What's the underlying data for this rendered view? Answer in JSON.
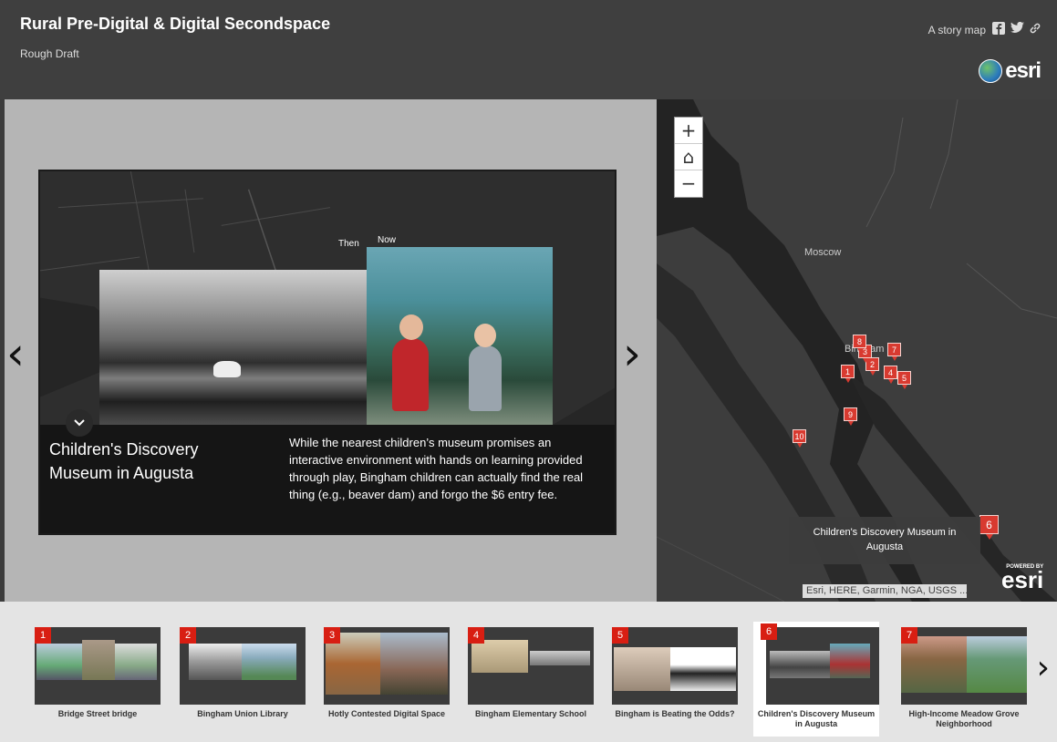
{
  "header": {
    "title": "Rural Pre-Digital & Digital Secondspace",
    "subtitle": "Rough Draft",
    "story_link": "A story map",
    "share_icons": [
      "facebook-icon",
      "twitter-icon",
      "link-icon"
    ],
    "logo_text": "esri"
  },
  "slide": {
    "then_label": "Then",
    "now_label": "Now",
    "title": "Children's Discovery Museum in Augusta",
    "description": "While the nearest children’s museum promises an interactive environment with hands on learning provided through play, Bingham children can actually find the real thing (e.g., beaver dam) and forgo the $6 entry fee.",
    "prev_glyph": "‹",
    "next_glyph": "›"
  },
  "map": {
    "zoom_in": "+",
    "home": "⌂",
    "zoom_out": "−",
    "labels": [
      "Moscow",
      "Bingham"
    ],
    "pins": [
      "1",
      "2",
      "3",
      "4",
      "5",
      "6",
      "7",
      "8",
      "9",
      "10"
    ],
    "active_pin": "6",
    "tooltip": "Children's Discovery Museum in Augusta",
    "attribution": "Esri, HERE, Garmin, NGA, USGS ...",
    "powered_by": "POWERED BY",
    "powered_logo": "esri"
  },
  "carousel": {
    "items": [
      {
        "num": "1",
        "label": "Bridge Street bridge"
      },
      {
        "num": "2",
        "label": "Bingham Union Library"
      },
      {
        "num": "3",
        "label": "Hotly Contested Digital Space"
      },
      {
        "num": "4",
        "label": "Bingham Elementary School"
      },
      {
        "num": "5",
        "label": "Bingham is Beating the Odds?"
      },
      {
        "num": "6",
        "label": "Children's Discovery Museum in Augusta"
      },
      {
        "num": "7",
        "label": "High-Income Meadow Grove Neighborhood"
      }
    ],
    "active_index": 5,
    "next_glyph": "›"
  },
  "colors": {
    "header_bg": "#3f3f3f",
    "pin_red": "#d83a30",
    "carousel_bg": "#e4e4e4",
    "stage_bg": "#b5b5b5"
  }
}
